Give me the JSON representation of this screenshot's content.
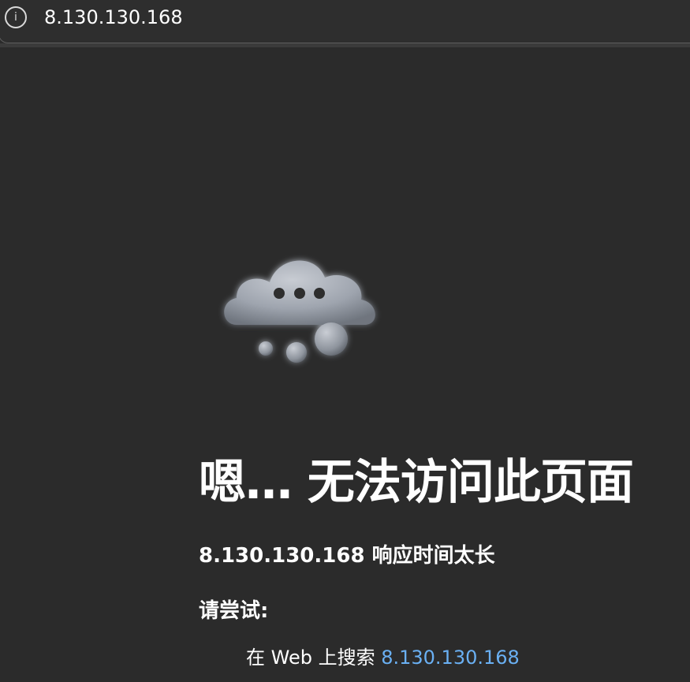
{
  "address_bar": {
    "info_icon": "info-icon",
    "url": "8.130.130.168"
  },
  "error": {
    "illustration": "thinking-cloud-icon",
    "heading": "嗯… 无法访问此页面",
    "message": "8.130.130.168 响应时间太长",
    "try_label": "请尝试:",
    "suggestions": [
      {
        "prefix": "在 Web 上搜索 ",
        "link": "8.130.130.168"
      }
    ]
  },
  "colors": {
    "background": "#2b2b2b",
    "text": "#ffffff",
    "link": "#6ab0f3"
  }
}
